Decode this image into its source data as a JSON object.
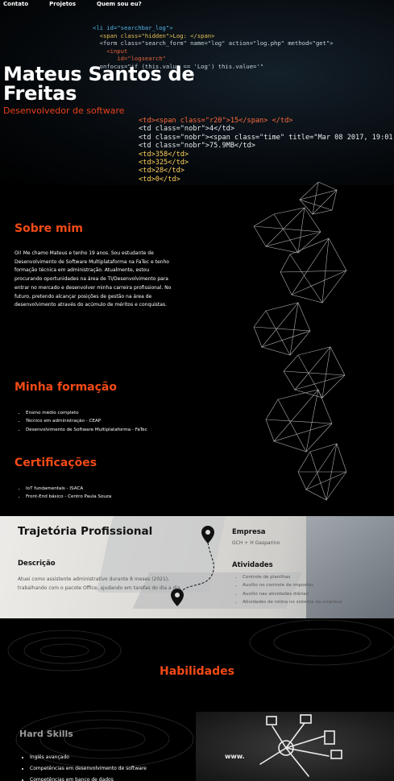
{
  "nav": {
    "items": [
      "Contato",
      "Projetos",
      "Quem sou eu?"
    ]
  },
  "hero": {
    "name": "Mateus Santos de Freitas",
    "role": "Desenvolvedor de software",
    "code_lines": [
      "<li id=\"searchbar_log\">",
      "  <span class=\"hidden\">Log: </span>",
      "  <form class=\"search_form\" name=\"log\" action=\"log.php\" method=\"get\">",
      "    <input",
      "       id=\"logsearch\"",
      "  onfocus=\"if (this.value == 'Log') this.value='\""
    ],
    "code_lines_2": [
      "<td><span class=\"r20\">15</span> </td>",
      "<td class=\"nobr\">4</td>",
      "<td class=\"nobr\"><span class=\"time\" title=\"Mar 08 2017, 19:01\">",
      "<td class=\"nobr\">75.9MB</td>",
      "<td>358</td>",
      "<td>325</td>",
      "<td>28</td>",
      "<td>0</td>"
    ]
  },
  "about": {
    "title": "Sobre mim",
    "text": "Oi! Me chamo Mateus e tenho 19 anos. Sou estudante de Desenvolvimento de Software Multiplataforma na FaTec e tenho formação técnica em administração. Atualmente, estou procurando oportunidades na área de TI/Desenvolvimento para entrar no mercado e desenvolver minha carreira profissional. No futuro, pretendo alcançar posições de gestão na área de desenvolvimento através do acúmulo de méritos e conquistas."
  },
  "education": {
    "title": "Minha formação",
    "items": [
      "Ensino médio completo",
      "Técnico em administração - CEAP",
      "Desenvolvimento de Software Multiplataforma - FaTec"
    ]
  },
  "certs": {
    "title": "Certificações",
    "items": [
      "IoT fundamentals - ISACA",
      "Front-End básico - Centro Paula Souza"
    ]
  },
  "career": {
    "title": "Trajetória Profissional",
    "company_label": "Empresa",
    "company": "GCH + H Gasparino",
    "description_label": "Descrição",
    "description": "Atuei como assistente administrativo durante 8 meses (2021), trabalhando com o pacote Office, ajudando em tarefas do dia a dia.",
    "activities_label": "Atividades",
    "activities": [
      "Controle de planilhas",
      "Auxílio no controle de impostos",
      "Auxílio nas atividades diárias",
      "Atividades de rotina no sistema da empresa"
    ]
  },
  "skills": {
    "title": "Habilidades",
    "hard_title": "Hard Skills",
    "hard_items": [
      "Inglês avançado",
      "Competências em desenvolvimento de software",
      "Competências em banco de dados"
    ],
    "chalk_text": "www."
  },
  "colors": {
    "accent": "#f24a16",
    "background": "#000000"
  }
}
